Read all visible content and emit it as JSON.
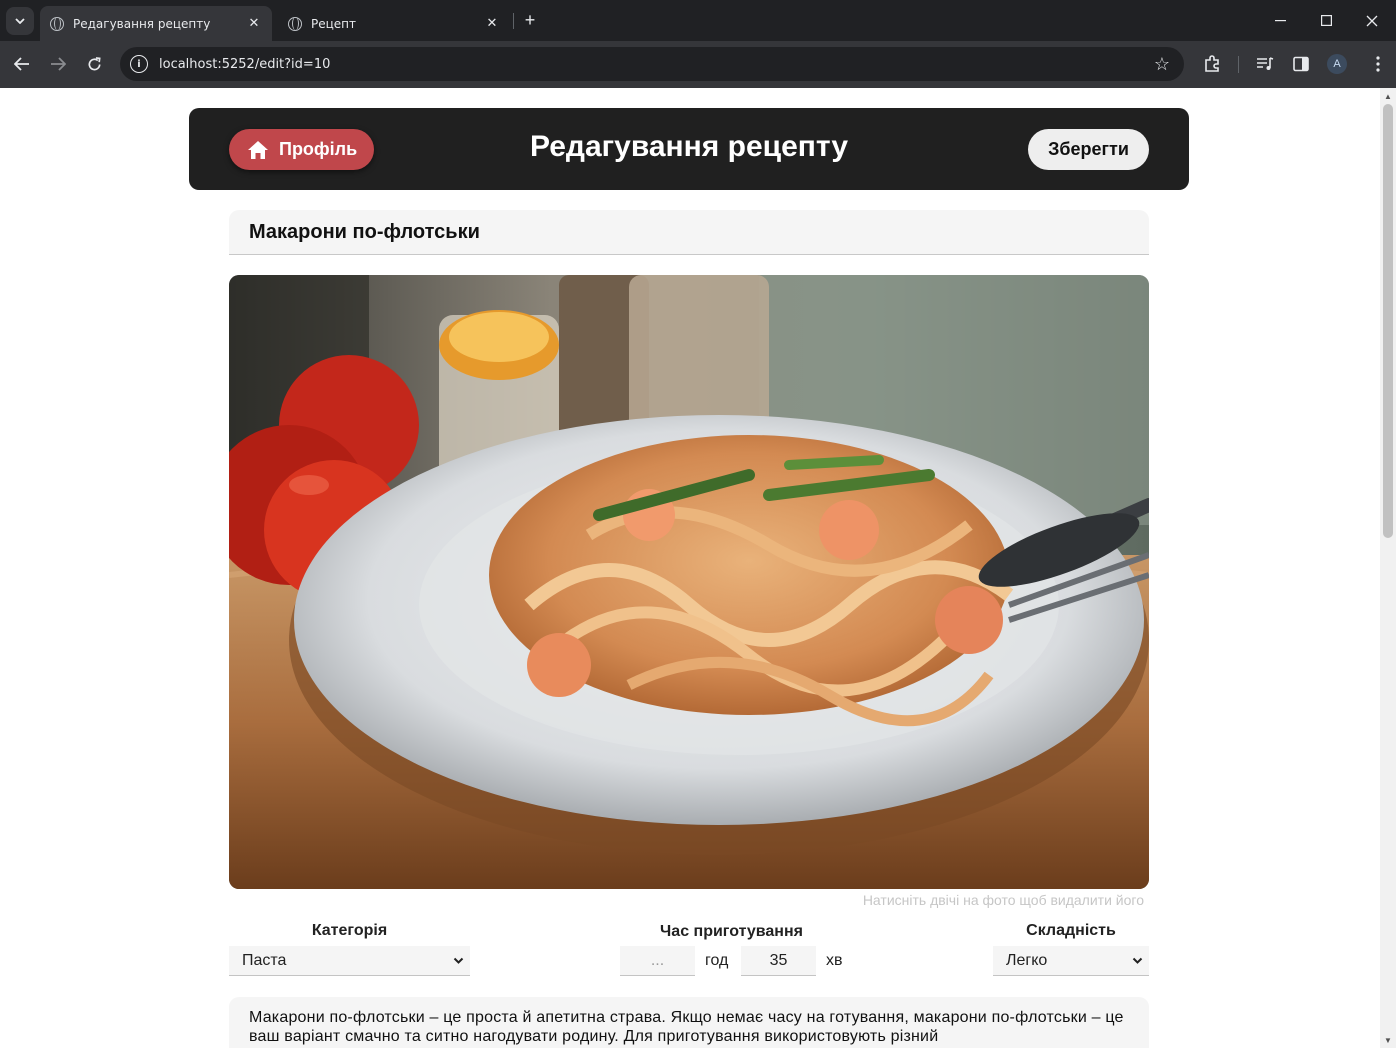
{
  "browser": {
    "tabs": [
      {
        "title": "Редагування рецепту",
        "active": true
      },
      {
        "title": "Рецепт",
        "active": false
      }
    ],
    "url": "localhost:5252/edit?id=10"
  },
  "header": {
    "profile_label": "Профіль",
    "title": "Редагування рецепту",
    "save_label": "Зберегти"
  },
  "recipe": {
    "title": "Макарони по-флотськи",
    "photo_hint": "Натисніть двічі на фото щоб видалити його",
    "category_label": "Категорія",
    "category_value": "Паста",
    "time_label": "Час приготування",
    "hours_placeholder": "...",
    "hours_unit": "год",
    "minutes_value": "35",
    "minutes_unit": "хв",
    "difficulty_label": "Складність",
    "difficulty_value": "Легко",
    "description": "Макарони по-флотськи – це проста й апетитна страва. Якщо немає часу на готування, макарони по-флотськи – це ваш варіант смачно та ситно нагодувати родину. Для приготування використовують різний"
  },
  "colors": {
    "header_bg": "#202020",
    "profile_button": "#c0474b",
    "save_button": "#eeeeee",
    "field_bg": "#f5f5f5",
    "browser_dark": "#202124",
    "browser_toolbar": "#35363a"
  },
  "icons": [
    "home-icon",
    "star-icon",
    "extensions-icon",
    "media-icon",
    "sidebar-icon",
    "back-icon",
    "forward-icon",
    "reload-icon"
  ]
}
